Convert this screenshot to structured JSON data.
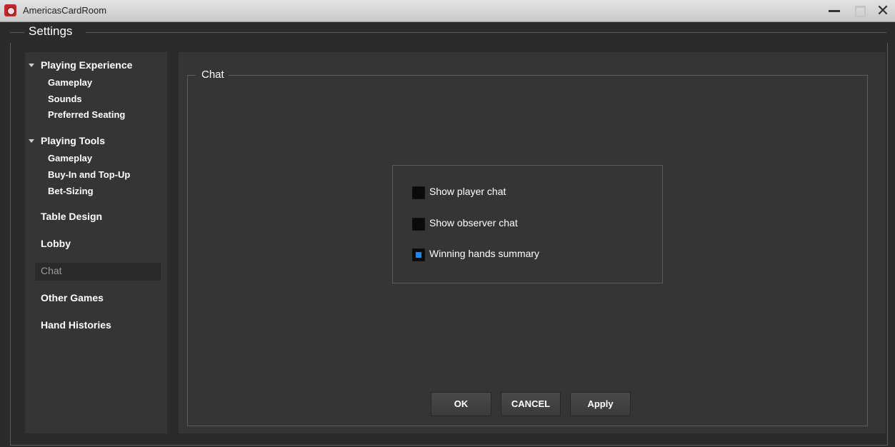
{
  "window": {
    "title": "AmericasCardRoom",
    "controls": [
      "minimize-icon",
      "maximize-icon",
      "close-icon"
    ],
    "close_glyph": "✕"
  },
  "settings": {
    "label": "Settings"
  },
  "sidebar": {
    "sections": [
      {
        "label": "Playing Experience",
        "expanded": true,
        "children": [
          "Gameplay",
          "Sounds",
          "Preferred Seating"
        ]
      },
      {
        "label": "Playing Tools",
        "expanded": true,
        "children": [
          "Gameplay",
          "Buy-In and Top-Up",
          "Bet-Sizing"
        ]
      }
    ],
    "items": [
      "Table Design",
      "Lobby",
      "Chat",
      "Other Games",
      "Hand Histories"
    ],
    "selected": "Chat"
  },
  "chat_panel": {
    "title": "Chat",
    "options": [
      {
        "label": "Show player chat",
        "checked": false
      },
      {
        "label": "Show observer chat",
        "checked": false
      },
      {
        "label": "Winning hands summary",
        "checked": true
      }
    ]
  },
  "buttons": {
    "ok": "OK",
    "cancel": "CANCEL",
    "apply": "Apply"
  },
  "colors": {
    "accent": "#1e88e5",
    "background": "#2b2b2b",
    "panel": "#353535"
  }
}
